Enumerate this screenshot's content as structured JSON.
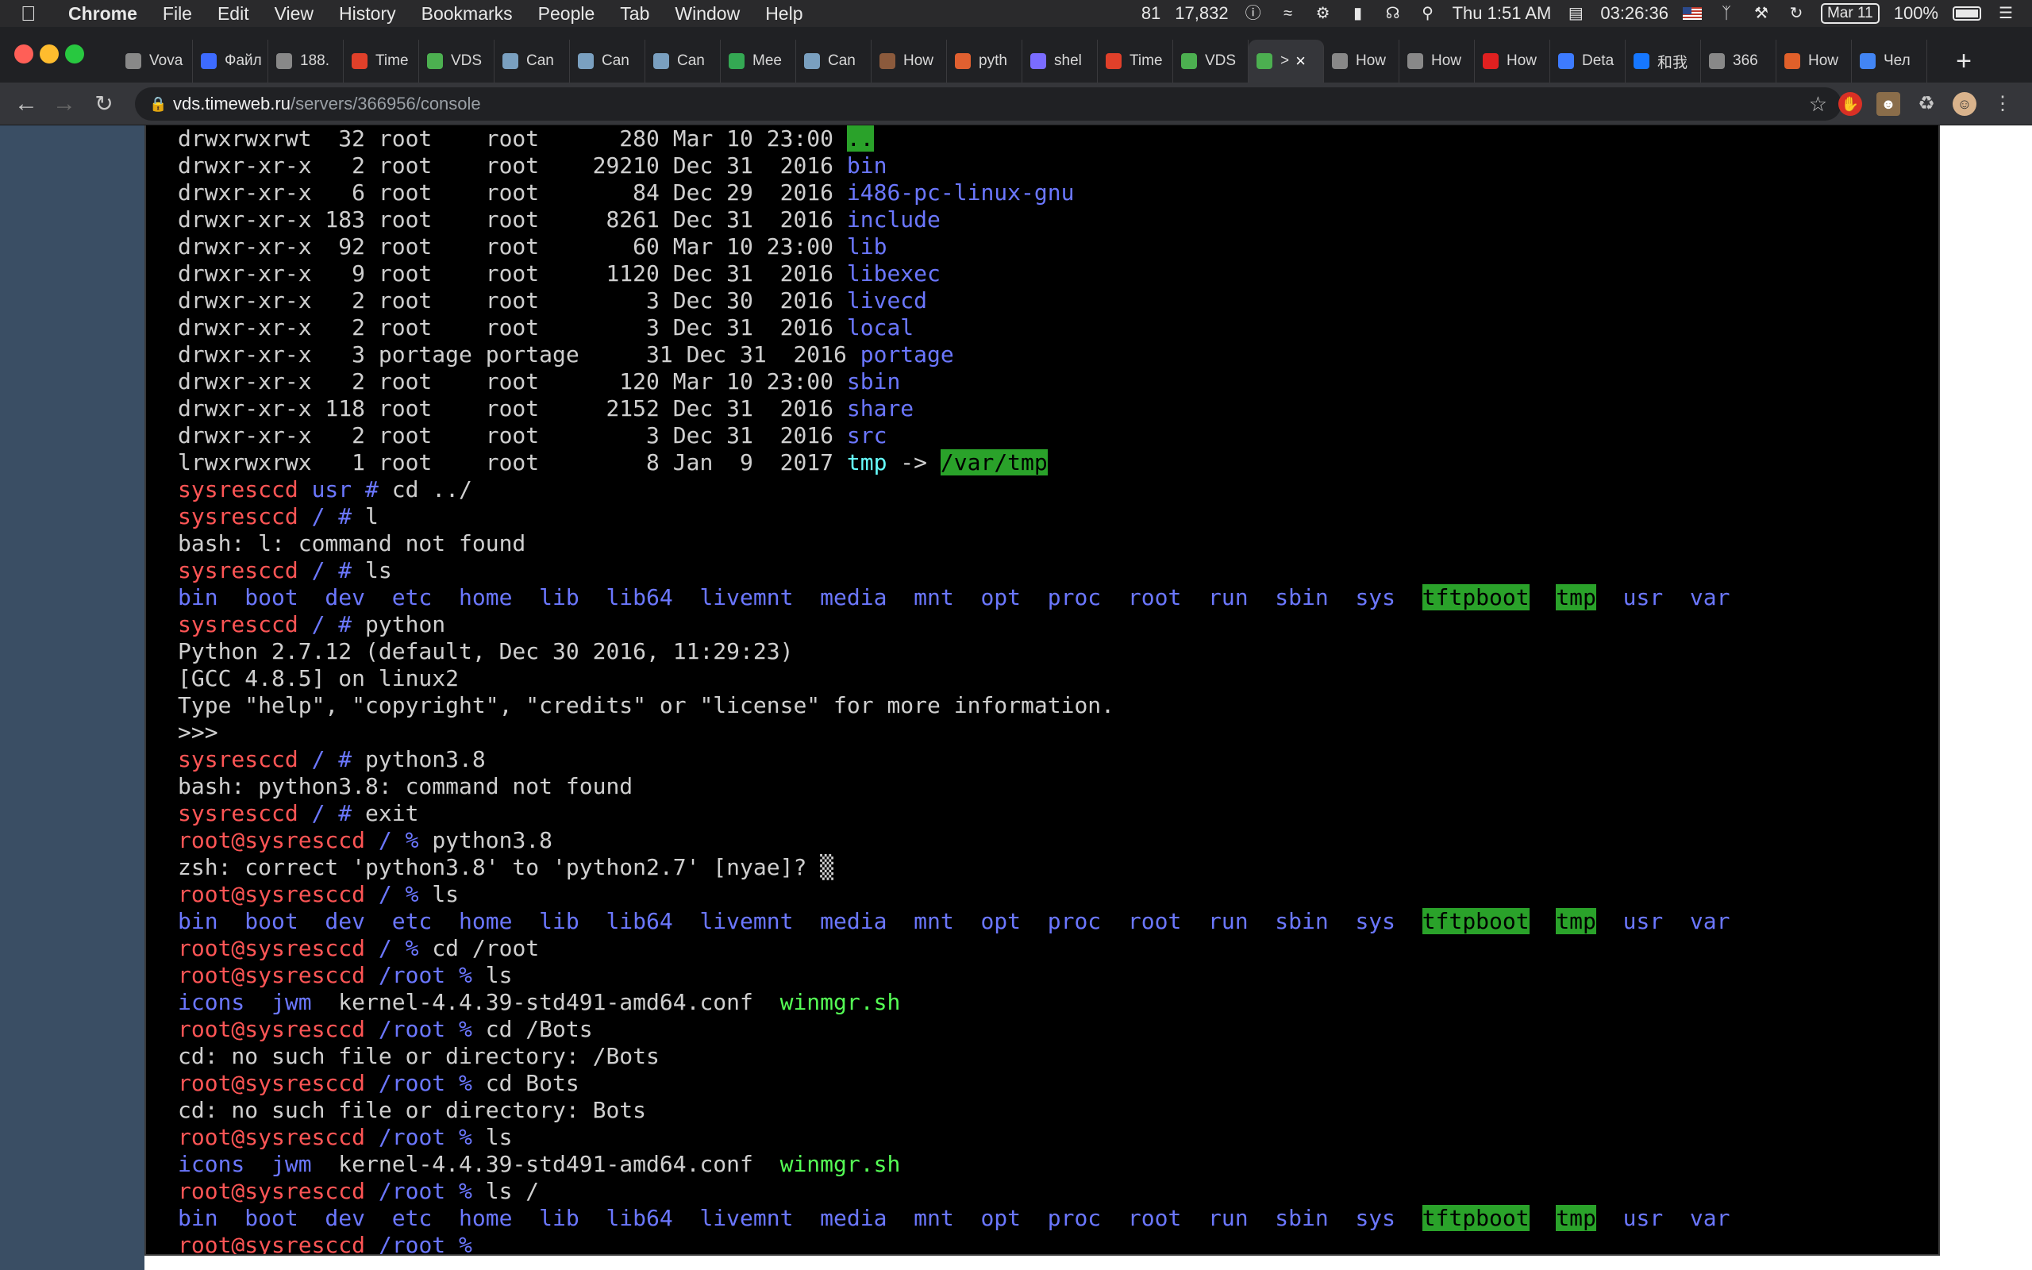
{
  "menubar": {
    "app_name": "Chrome",
    "menus": [
      "File",
      "Edit",
      "View",
      "History",
      "Bookmarks",
      "People",
      "Tab",
      "Window",
      "Help"
    ],
    "status": {
      "count_a": "81",
      "count_b": "17,832",
      "clock": "Thu 1:51 AM",
      "timer": "03:26:36",
      "date_badge": "Mar 11",
      "battery": "100%"
    }
  },
  "tabs": [
    {
      "label": "Vova",
      "icon": "generic-favicon",
      "color": "#888888"
    },
    {
      "label": "Файл",
      "icon": "dropbox-icon",
      "color": "#3d6bff"
    },
    {
      "label": "188.",
      "icon": "globe-icon",
      "color": "#888888"
    },
    {
      "label": "Time",
      "icon": "chevron-icon",
      "color": "#e0402a"
    },
    {
      "label": "VDS",
      "icon": "play-icon",
      "color": "#4caf50"
    },
    {
      "label": "Can",
      "icon": "gear-icon",
      "color": "#7aa0c0"
    },
    {
      "label": "Can",
      "icon": "gear-icon",
      "color": "#7aa0c0"
    },
    {
      "label": "Can",
      "icon": "gear-icon",
      "color": "#7aa0c0"
    },
    {
      "label": "Mee",
      "icon": "meet-icon",
      "color": "#34a853"
    },
    {
      "label": "Can",
      "icon": "gear-icon",
      "color": "#7aa0c0"
    },
    {
      "label": "How",
      "icon": "avatar-icon",
      "color": "#8b5a3c"
    },
    {
      "label": "pyth",
      "icon": "python-icon",
      "color": "#e06030"
    },
    {
      "label": "shel",
      "icon": "shell-icon",
      "color": "#7a6cff"
    },
    {
      "label": "Time",
      "icon": "chevron-icon",
      "color": "#e0402a"
    },
    {
      "label": "VDS",
      "icon": "play-icon",
      "color": "#4caf50"
    },
    {
      "label": ">",
      "icon": "play-icon",
      "color": "#4caf50",
      "active": true
    },
    {
      "label": "How",
      "icon": "generic-favicon",
      "color": "#888888"
    },
    {
      "label": "How",
      "icon": "generic-favicon",
      "color": "#888888"
    },
    {
      "label": "How",
      "icon": "redhat-icon",
      "color": "#e02020"
    },
    {
      "label": "Deta",
      "icon": "diamond-icon",
      "color": "#3d7bff"
    },
    {
      "label": "和我",
      "icon": "zhihu-icon",
      "color": "#1677ff"
    },
    {
      "label": "366",
      "icon": "globe-icon",
      "color": "#888888"
    },
    {
      "label": "How",
      "icon": "linkedin-icon",
      "color": "#e0602a"
    },
    {
      "label": "Чел",
      "icon": "google-icon",
      "color": "#4285f4"
    }
  ],
  "address": {
    "host": "vds.timeweb.ru",
    "path": "/servers/366956/console"
  },
  "colors": {
    "prompt_red": "#ff5555",
    "dir_blue": "#6b77ff",
    "exec_green": "#55ff55",
    "highlight_bg": "#2aa22a",
    "panel": "#3a4e64"
  },
  "terminal": {
    "lines": [
      [
        {
          "t": "drwxrwxrwt  32 root    root      280 Mar 10 23:00 ",
          "c": "w"
        },
        {
          "t": "..",
          "c": "greenbg"
        }
      ],
      [
        {
          "t": "drwxr-xr-x   2 root    root    29210 Dec 31  2016 ",
          "c": "w"
        },
        {
          "t": "bin",
          "c": "blue"
        }
      ],
      [
        {
          "t": "drwxr-xr-x   6 root    root       84 Dec 29  2016 ",
          "c": "w"
        },
        {
          "t": "i486-pc-linux-gnu",
          "c": "blue"
        }
      ],
      [
        {
          "t": "drwxr-xr-x 183 root    root     8261 Dec 31  2016 ",
          "c": "w"
        },
        {
          "t": "include",
          "c": "blue"
        }
      ],
      [
        {
          "t": "drwxr-xr-x  92 root    root       60 Mar 10 23:00 ",
          "c": "w"
        },
        {
          "t": "lib",
          "c": "blue"
        }
      ],
      [
        {
          "t": "drwxr-xr-x   9 root    root     1120 Dec 31  2016 ",
          "c": "w"
        },
        {
          "t": "libexec",
          "c": "blue"
        }
      ],
      [
        {
          "t": "drwxr-xr-x   2 root    root        3 Dec 30  2016 ",
          "c": "w"
        },
        {
          "t": "livecd",
          "c": "blue"
        }
      ],
      [
        {
          "t": "drwxr-xr-x   2 root    root        3 Dec 31  2016 ",
          "c": "w"
        },
        {
          "t": "local",
          "c": "blue"
        }
      ],
      [
        {
          "t": "drwxr-xr-x   3 portage portage     31 Dec 31  2016 ",
          "c": "w"
        },
        {
          "t": "portage",
          "c": "blue"
        }
      ],
      [
        {
          "t": "drwxr-xr-x   2 root    root      120 Mar 10 23:00 ",
          "c": "w"
        },
        {
          "t": "sbin",
          "c": "blue"
        }
      ],
      [
        {
          "t": "drwxr-xr-x 118 root    root     2152 Dec 31  2016 ",
          "c": "w"
        },
        {
          "t": "share",
          "c": "blue"
        }
      ],
      [
        {
          "t": "drwxr-xr-x   2 root    root        3 Dec 31  2016 ",
          "c": "w"
        },
        {
          "t": "src",
          "c": "blue"
        }
      ],
      [
        {
          "t": "lrwxrwxrwx   1 root    root        8 Jan  9  2017 ",
          "c": "w"
        },
        {
          "t": "tmp",
          "c": "cyan"
        },
        {
          "t": " -> ",
          "c": "w"
        },
        {
          "t": "/var/tmp",
          "c": "greenbg"
        }
      ],
      [
        {
          "t": "sysresccd ",
          "c": "red"
        },
        {
          "t": "usr # ",
          "c": "blue"
        },
        {
          "t": "cd ../",
          "c": "w"
        }
      ],
      [
        {
          "t": "sysresccd ",
          "c": "red"
        },
        {
          "t": "/ # ",
          "c": "blue"
        },
        {
          "t": "l",
          "c": "w"
        }
      ],
      [
        {
          "t": "bash: l: command not found",
          "c": "w"
        }
      ],
      [
        {
          "t": "sysresccd ",
          "c": "red"
        },
        {
          "t": "/ # ",
          "c": "blue"
        },
        {
          "t": "ls",
          "c": "w"
        }
      ],
      [
        {
          "t": "bin  boot  dev  etc  home  lib  lib64  livemnt  media  mnt  opt  proc  root  run  sbin  sys  ",
          "c": "blue"
        },
        {
          "t": "tftpboot",
          "c": "greenbg"
        },
        {
          "t": "  ",
          "c": "w"
        },
        {
          "t": "tmp",
          "c": "greenbg"
        },
        {
          "t": "  usr  var",
          "c": "blue"
        }
      ],
      [
        {
          "t": "sysresccd ",
          "c": "red"
        },
        {
          "t": "/ # ",
          "c": "blue"
        },
        {
          "t": "python",
          "c": "w"
        }
      ],
      [
        {
          "t": "Python 2.7.12 (default, Dec 30 2016, 11:29:23)",
          "c": "w"
        }
      ],
      [
        {
          "t": "[GCC 4.8.5] on linux2",
          "c": "w"
        }
      ],
      [
        {
          "t": "Type \"help\", \"copyright\", \"credits\" or \"license\" for more information.",
          "c": "w"
        }
      ],
      [
        {
          "t": ">>>",
          "c": "w"
        }
      ],
      [
        {
          "t": "sysresccd ",
          "c": "red"
        },
        {
          "t": "/ # ",
          "c": "blue"
        },
        {
          "t": "python3.8",
          "c": "w"
        }
      ],
      [
        {
          "t": "bash: python3.8: command not found",
          "c": "w"
        }
      ],
      [
        {
          "t": "sysresccd ",
          "c": "red"
        },
        {
          "t": "/ # ",
          "c": "blue"
        },
        {
          "t": "exit",
          "c": "w"
        }
      ],
      [
        {
          "t": "root@sysresccd ",
          "c": "red"
        },
        {
          "t": "/ % ",
          "c": "blue"
        },
        {
          "t": "python3.8",
          "c": "w"
        }
      ],
      [
        {
          "t": "zsh: correct 'python3.8' to 'python2.7' [nyae]? ",
          "c": "w"
        },
        {
          "t": "▒",
          "c": "w"
        }
      ],
      [
        {
          "t": "root@sysresccd ",
          "c": "red"
        },
        {
          "t": "/ % ",
          "c": "blue"
        },
        {
          "t": "ls",
          "c": "w"
        }
      ],
      [
        {
          "t": "bin  boot  dev  etc  home  lib  lib64  livemnt  media  mnt  opt  proc  root  run  sbin  sys  ",
          "c": "blue"
        },
        {
          "t": "tftpboot",
          "c": "greenbg"
        },
        {
          "t": "  ",
          "c": "w"
        },
        {
          "t": "tmp",
          "c": "greenbg"
        },
        {
          "t": "  usr  var",
          "c": "blue"
        }
      ],
      [
        {
          "t": "root@sysresccd ",
          "c": "red"
        },
        {
          "t": "/ % ",
          "c": "blue"
        },
        {
          "t": "cd /root",
          "c": "w"
        }
      ],
      [
        {
          "t": "root@sysresccd ",
          "c": "red"
        },
        {
          "t": "/root % ",
          "c": "blue"
        },
        {
          "t": "ls",
          "c": "w"
        }
      ],
      [
        {
          "t": "icons  jwm  ",
          "c": "blue"
        },
        {
          "t": "kernel-4.4.39-std491-amd64.conf  ",
          "c": "w"
        },
        {
          "t": "winmgr.sh",
          "c": "green"
        }
      ],
      [
        {
          "t": "root@sysresccd ",
          "c": "red"
        },
        {
          "t": "/root % ",
          "c": "blue"
        },
        {
          "t": "cd /Bots",
          "c": "w"
        }
      ],
      [
        {
          "t": "cd: no such file or directory: /Bots",
          "c": "w"
        }
      ],
      [
        {
          "t": "root@sysresccd ",
          "c": "red"
        },
        {
          "t": "/root % ",
          "c": "blue"
        },
        {
          "t": "cd Bots",
          "c": "w"
        }
      ],
      [
        {
          "t": "cd: no such file or directory: Bots",
          "c": "w"
        }
      ],
      [
        {
          "t": "root@sysresccd ",
          "c": "red"
        },
        {
          "t": "/root % ",
          "c": "blue"
        },
        {
          "t": "ls",
          "c": "w"
        }
      ],
      [
        {
          "t": "icons  jwm  ",
          "c": "blue"
        },
        {
          "t": "kernel-4.4.39-std491-amd64.conf  ",
          "c": "w"
        },
        {
          "t": "winmgr.sh",
          "c": "green"
        }
      ],
      [
        {
          "t": "root@sysresccd ",
          "c": "red"
        },
        {
          "t": "/root % ",
          "c": "blue"
        },
        {
          "t": "ls /",
          "c": "w"
        }
      ],
      [
        {
          "t": "bin  boot  dev  etc  home  lib  lib64  livemnt  media  mnt  opt  proc  root  run  sbin  sys  ",
          "c": "blue"
        },
        {
          "t": "tftpboot",
          "c": "greenbg"
        },
        {
          "t": "  ",
          "c": "w"
        },
        {
          "t": "tmp",
          "c": "greenbg"
        },
        {
          "t": "  usr  var",
          "c": "blue"
        }
      ],
      [
        {
          "t": "root@sysresccd ",
          "c": "red"
        },
        {
          "t": "/root % ",
          "c": "blue"
        },
        {
          "t": "_",
          "c": "w"
        }
      ]
    ]
  }
}
